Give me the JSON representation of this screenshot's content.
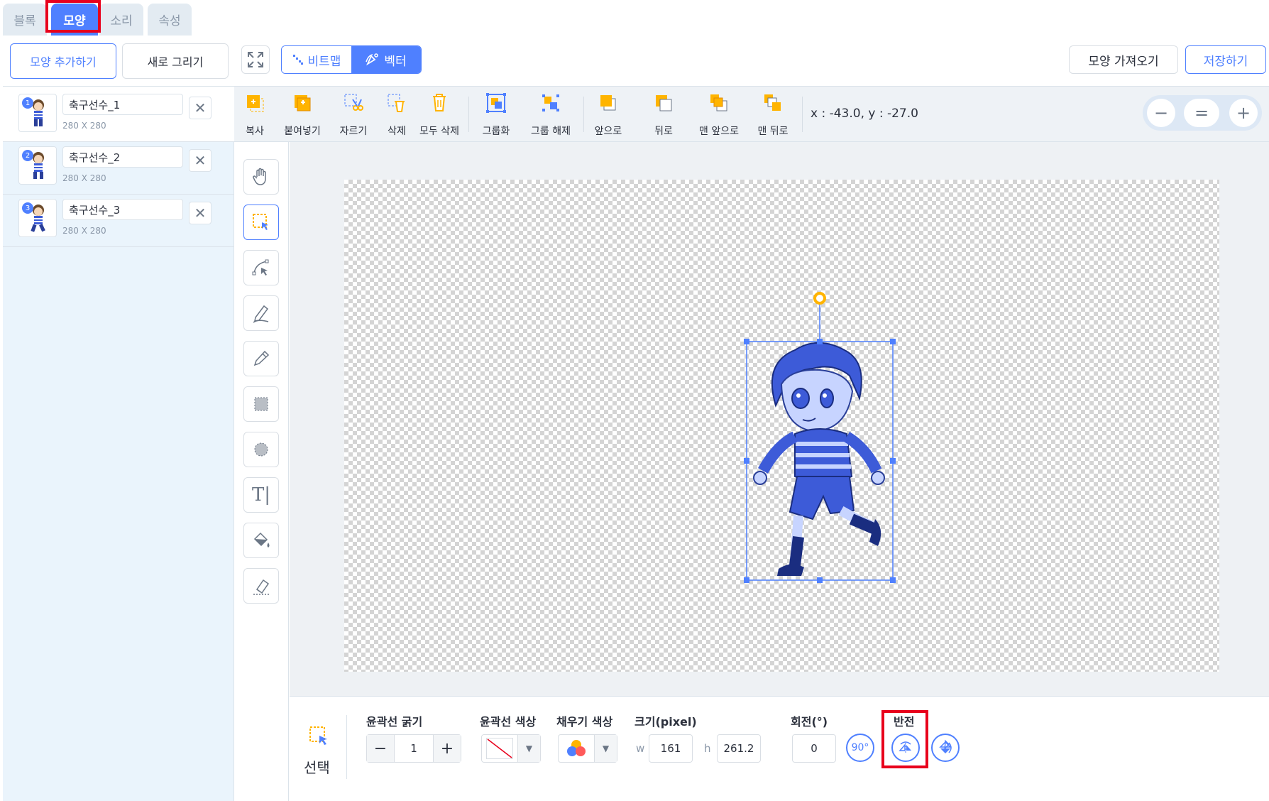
{
  "tabs": [
    {
      "label": "블록",
      "active": false
    },
    {
      "label": "모양",
      "active": true
    },
    {
      "label": "소리",
      "active": false
    },
    {
      "label": "속성",
      "active": false
    }
  ],
  "left_panel": {
    "add_label": "모양 추가하기",
    "new_label": "새로 그리기",
    "costumes": [
      {
        "num": "1",
        "name": "축구선수_1",
        "size": "280 X 280"
      },
      {
        "num": "2",
        "name": "축구선수_2",
        "size": "280 X 280"
      },
      {
        "num": "3",
        "name": "축구선수_3",
        "size": "280 X 280"
      }
    ]
  },
  "header": {
    "bitmap_label": "비트맵",
    "vector_label": "벡터",
    "import_label": "모양 가져오기",
    "save_label": "저장하기"
  },
  "toolbar": {
    "tools": [
      "복사",
      "붙여넣기",
      "자르기",
      "삭제",
      "모두 삭제",
      "그룹화",
      "그룹 해제",
      "앞으로",
      "뒤로",
      "맨 앞으로",
      "맨 뒤로"
    ],
    "coords": "x : -43.0, y : -27.0",
    "zoom": {
      "minus": "−",
      "reset": "=",
      "plus": "+"
    }
  },
  "tool_column": [
    "hand-icon",
    "select-icon",
    "path-select-icon",
    "pen-icon",
    "pencil-icon",
    "rectangle-icon",
    "ellipse-icon",
    "text-icon",
    "fill-icon",
    "eraser-icon"
  ],
  "properties": {
    "selected_tool": "선택",
    "stroke_width_label": "윤곽선 굵기",
    "stroke_width": "1",
    "stroke_color_label": "윤곽선 색상",
    "fill_color_label": "채우기 색상",
    "size_label": "크기(pixel)",
    "w_label": "w",
    "w_value": "161",
    "h_label": "h",
    "h_value": "261.2",
    "rotation_label": "회전(°)",
    "rotation_value": "0",
    "rotate90_label": "90°",
    "flip_label": "반전"
  },
  "colors": {
    "accent": "#4f80ff",
    "highlight": "#e8001c"
  }
}
